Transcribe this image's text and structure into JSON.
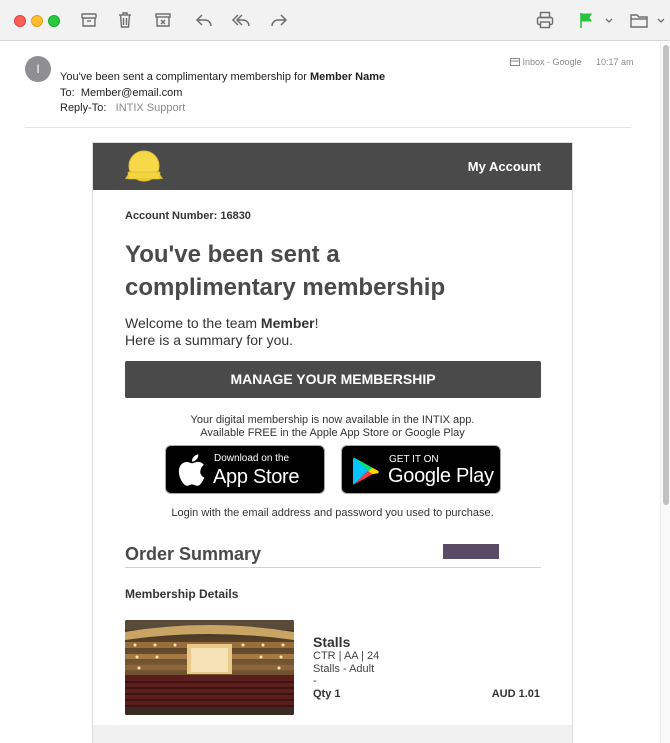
{
  "toolbar": {
    "icons": [
      "archive-icon",
      "trash-icon",
      "junk-icon",
      "reply-icon",
      "reply-all-icon",
      "forward-icon",
      "print-icon",
      "flag-icon",
      "move-to-folder-icon"
    ],
    "flag_color": "#2ac240"
  },
  "header": {
    "avatar_initial": "I",
    "subject_prefix": "You've been sent a complimentary membership for ",
    "subject_name": "Member Name",
    "to_label": "To:",
    "to_value": "Member@email.com",
    "replyto_label": "Reply-To:",
    "replyto_value": "INTIX Support",
    "mailbox": "Inbox - Google",
    "time": "10:17 am"
  },
  "email": {
    "banner_link": "My Account",
    "account_number": "Account Number: 16830",
    "headline_line1": "You've been sent a",
    "headline_line2": "complimentary membership",
    "welcome_prefix": "Welcome to the team ",
    "welcome_name": "Member",
    "welcome_suffix": "!",
    "summary_line": "Here is a summary for you.",
    "manage_button": "MANAGE YOUR MEMBERSHIP",
    "app_note_line1": "Your digital membership is now available in the INTIX app.",
    "app_note_line2": "Available FREE in the Apple App Store or Google Play",
    "app_store_small": "Download on the",
    "app_store_big": "App Store",
    "google_play_small": "GET IT ON",
    "google_play_big": "Google Play",
    "login_note": "Login with the email address and password you used to purchase.",
    "order_summary_title": "Order Summary",
    "details_title": "Membership Details",
    "item": {
      "name": "Stalls",
      "seat": "CTR | AA | 24",
      "type": "Stalls - Adult",
      "dash": "-",
      "qty": "Qty 1",
      "price": "AUD 1.01"
    }
  },
  "colors": {
    "banner": "#4a4a4a",
    "button": "#4a4a4a",
    "swatch": "#5b4a66"
  }
}
